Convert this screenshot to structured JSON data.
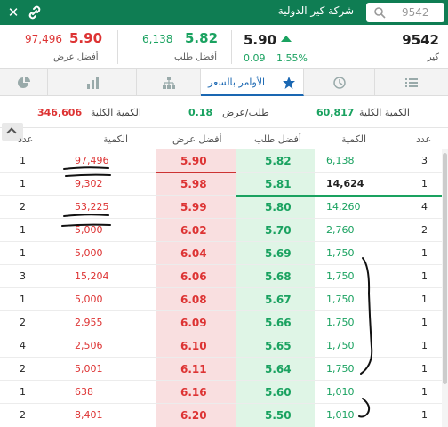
{
  "header": {
    "search_value": "9542",
    "title": "شركة كير الدولية",
    "close_icon": "close-icon",
    "link_icon": "link-icon",
    "search_icon": "search-icon",
    "bg_color": "#0f7d53"
  },
  "quote": {
    "symbol": "9542",
    "symbol_sub": "كير",
    "last_price": "5.90",
    "change": "0.09",
    "change_pct": "1.55%",
    "best_bid_label": "أفضل طلب",
    "best_bid_price": "5.82",
    "best_bid_qty": "6,138",
    "best_ask_label": "أفضل عرض",
    "best_ask_price": "5.90",
    "best_ask_qty": "97,496"
  },
  "tabs": [
    {
      "name": "list",
      "icon": "list-icon",
      "label": ""
    },
    {
      "name": "history",
      "icon": "clock-icon",
      "label": ""
    },
    {
      "name": "orders-by-price",
      "icon": "star-icon",
      "label": "الأوامر بالسعر",
      "active": true
    },
    {
      "name": "hierarchy",
      "icon": "hierarchy-icon",
      "label": ""
    },
    {
      "name": "chart",
      "icon": "bar-chart-icon",
      "label": ""
    },
    {
      "name": "other",
      "icon": "pie-icon",
      "label": ""
    }
  ],
  "summary": {
    "total_bid_label": "الكمية الكلية",
    "total_bid_value": "60,817",
    "ratio_label": "طلب/عرض",
    "ratio_value": "0.18",
    "total_ask_label": "الكمية الكلية",
    "total_ask_value": "346,606"
  },
  "table": {
    "headers": {
      "ask_count": "عدد",
      "ask_qty": "الكمية",
      "ask_price": "أفضل عرض",
      "bid_price": "أفضل طلب",
      "bid_qty": "الكمية",
      "bid_count": "عدد"
    },
    "rows": [
      {
        "ask_count": "1",
        "ask_qty": "97,496",
        "ask_price": "5.90",
        "bid_price": "5.82",
        "bid_qty": "6,138",
        "bid_count": "3"
      },
      {
        "ask_count": "1",
        "ask_qty": "9,302",
        "ask_price": "5.98",
        "bid_price": "5.81",
        "bid_qty": "14,624",
        "bid_count": "1"
      },
      {
        "ask_count": "2",
        "ask_qty": "53,225",
        "ask_price": "5.99",
        "bid_price": "5.80",
        "bid_qty": "14,260",
        "bid_count": "4"
      },
      {
        "ask_count": "1",
        "ask_qty": "5,000",
        "ask_price": "6.02",
        "bid_price": "5.70",
        "bid_qty": "2,760",
        "bid_count": "2"
      },
      {
        "ask_count": "1",
        "ask_qty": "5,000",
        "ask_price": "6.04",
        "bid_price": "5.69",
        "bid_qty": "1,750",
        "bid_count": "1"
      },
      {
        "ask_count": "3",
        "ask_qty": "15,204",
        "ask_price": "6.06",
        "bid_price": "5.68",
        "bid_qty": "1,750",
        "bid_count": "1"
      },
      {
        "ask_count": "1",
        "ask_qty": "5,000",
        "ask_price": "6.08",
        "bid_price": "5.67",
        "bid_qty": "1,750",
        "bid_count": "1"
      },
      {
        "ask_count": "2",
        "ask_qty": "2,955",
        "ask_price": "6.09",
        "bid_price": "5.66",
        "bid_qty": "1,750",
        "bid_count": "1"
      },
      {
        "ask_count": "4",
        "ask_qty": "2,506",
        "ask_price": "6.10",
        "bid_price": "5.65",
        "bid_qty": "1,750",
        "bid_count": "1"
      },
      {
        "ask_count": "2",
        "ask_qty": "5,001",
        "ask_price": "6.11",
        "bid_price": "5.64",
        "bid_qty": "1,750",
        "bid_count": "1"
      },
      {
        "ask_count": "1",
        "ask_qty": "638",
        "ask_price": "6.16",
        "bid_price": "5.60",
        "bid_qty": "1,010",
        "bid_count": "1"
      },
      {
        "ask_count": "2",
        "ask_qty": "8,401",
        "ask_price": "6.20",
        "bid_price": "5.50",
        "bid_qty": "1,010",
        "bid_count": "1"
      }
    ]
  },
  "colors": {
    "ask": "#d33333",
    "bid": "#1aa260",
    "ask_bg": "#f9dfe0",
    "bid_bg": "#dff5e6",
    "accent": "#1a67b2"
  }
}
